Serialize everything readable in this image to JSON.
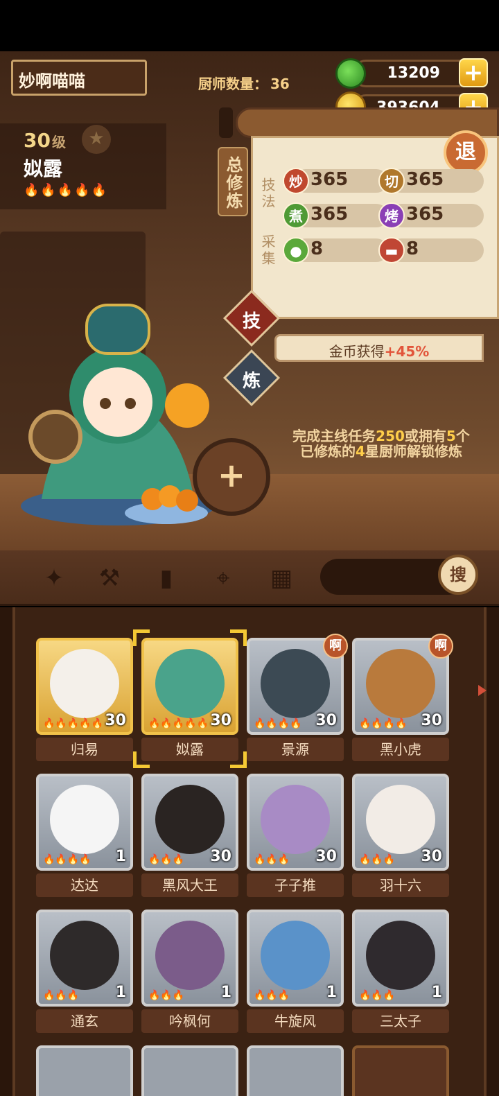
{
  "header": {
    "player_name": "妙啊喵喵",
    "chef_count_label": "厨师数量：",
    "chef_count": "36",
    "jade": "13209",
    "coins": "393604",
    "plus_symbol": "+"
  },
  "selected_chef": {
    "level": "30",
    "level_unit": "级",
    "name": "姒露",
    "flames": "🔥🔥🔥🔥🔥",
    "rarity_stars": 5
  },
  "panel": {
    "tab_label": "总修炼",
    "back_label": "退",
    "skill_section": "技法",
    "gather_section": "采集",
    "skills": [
      {
        "icon": "炒",
        "value": "365",
        "color": "#c0482e"
      },
      {
        "icon": "切",
        "value": "365",
        "color": "#b0782c"
      },
      {
        "icon": "煮",
        "value": "365",
        "color": "#4f9a35"
      },
      {
        "icon": "烤",
        "value": "365",
        "color": "#8a3fb5"
      }
    ],
    "gather": [
      {
        "icon": "veg-icon",
        "value": "8",
        "color": "#5aa83a"
      },
      {
        "icon": "meat-icon",
        "value": "8",
        "color": "#c04634"
      }
    ],
    "skill_btn": "技",
    "train_btn": "炼",
    "gold_bonus_label": "金币获得",
    "gold_bonus_value": "+45%",
    "unlock_text_1": "完成主线任务",
    "unlock_num_1": "250",
    "unlock_text_2": "或拥有",
    "unlock_num_2": "5",
    "unlock_text_3": "个",
    "unlock_text_4": "已修炼的",
    "unlock_num_3": "4",
    "unlock_text_5": "星厨师解锁修炼",
    "add_symbol": "+"
  },
  "filters": {
    "search_label": "搜",
    "search_placeholder": ""
  },
  "roster": [
    {
      "name": "归易",
      "level": "30",
      "flames": "🔥🔥🔥🔥🔥",
      "tier": "gold",
      "badge": "",
      "color": "#f4f0ea"
    },
    {
      "name": "姒露",
      "level": "30",
      "flames": "🔥🔥🔥🔥🔥",
      "tier": "gold",
      "badge": "",
      "color": "#4aa38b",
      "selected": true
    },
    {
      "name": "景源",
      "level": "30",
      "flames": "🔥🔥🔥🔥",
      "tier": "silver",
      "badge": "啊",
      "color": "#3c4a54"
    },
    {
      "name": "黑小虎",
      "level": "30",
      "flames": "🔥🔥🔥🔥",
      "tier": "silver",
      "badge": "啊",
      "color": "#b97a3c"
    },
    {
      "name": "达达",
      "level": "1",
      "flames": "🔥🔥🔥🔥",
      "tier": "silver",
      "badge": "",
      "color": "#f5f5f5"
    },
    {
      "name": "黑风大王",
      "level": "30",
      "flames": "🔥🔥🔥",
      "tier": "silver",
      "badge": "",
      "color": "#2a2422"
    },
    {
      "name": "子子推",
      "level": "30",
      "flames": "🔥🔥🔥",
      "tier": "silver",
      "badge": "",
      "color": "#a88bc5"
    },
    {
      "name": "羽十六",
      "level": "30",
      "flames": "🔥🔥🔥",
      "tier": "silver",
      "badge": "",
      "color": "#f2ece6"
    },
    {
      "name": "通玄",
      "level": "1",
      "flames": "🔥🔥🔥",
      "tier": "silver",
      "badge": "",
      "color": "#2e2a2a"
    },
    {
      "name": "吟枫何",
      "level": "1",
      "flames": "🔥🔥🔥",
      "tier": "silver",
      "badge": "",
      "color": "#7b5c8a"
    },
    {
      "name": "牛旋风",
      "level": "1",
      "flames": "🔥🔥🔥",
      "tier": "silver",
      "badge": "",
      "color": "#5a92c9"
    },
    {
      "name": "三太子",
      "level": "1",
      "flames": "🔥🔥🔥",
      "tier": "silver",
      "badge": "",
      "color": "#2f2a2e"
    }
  ]
}
